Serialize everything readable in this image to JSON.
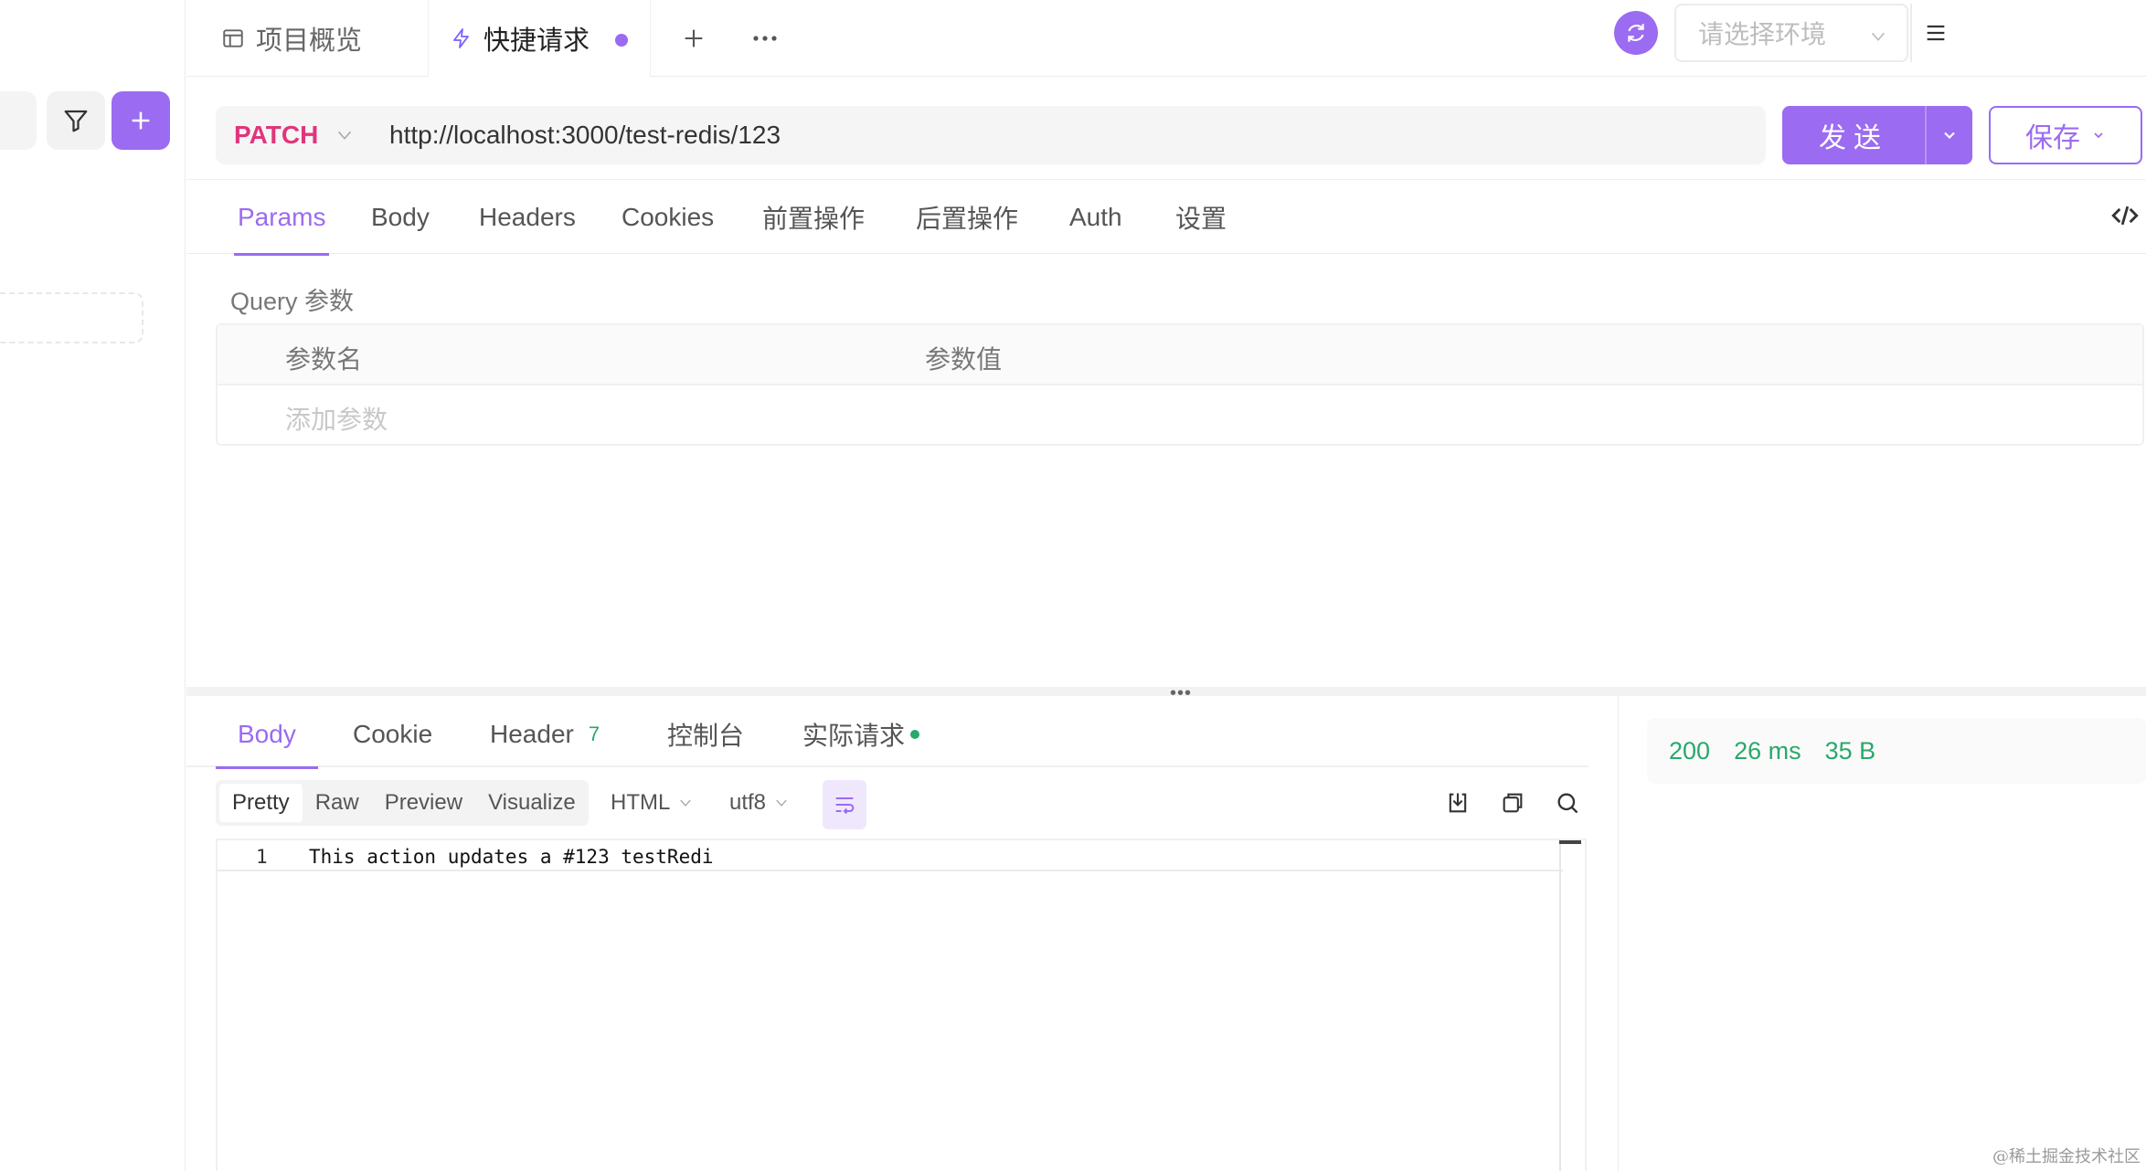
{
  "tabs": {
    "overview": "项目概览",
    "quick_request": "快捷请求",
    "add": "+",
    "more": "···"
  },
  "environment": {
    "placeholder": "请选择环境"
  },
  "request": {
    "method": "PATCH",
    "url": "http://localhost:3000/test-redis/123",
    "send_label": "发送",
    "save_label": "保存"
  },
  "request_tabs": [
    "Params",
    "Body",
    "Headers",
    "Cookies",
    "前置操作",
    "后置操作",
    "Auth",
    "设置"
  ],
  "params": {
    "section_label": "Query 参数",
    "col_name": "参数名",
    "col_value": "参数值",
    "add_placeholder": "添加参数"
  },
  "response": {
    "tabs": {
      "body": "Body",
      "cookie": "Cookie",
      "header": "Header",
      "header_count": "7",
      "console": "控制台",
      "actual_request": "实际请求"
    },
    "formats": [
      "Pretty",
      "Raw",
      "Preview",
      "Visualize"
    ],
    "content_type": "HTML",
    "encoding": "utf8",
    "lines": [
      {
        "number": "1",
        "text": "This action updates a #123 testRedi"
      }
    ],
    "status": "200",
    "time": "26 ms",
    "size": "35 B"
  },
  "watermark": "@稀土掘金技术社区",
  "colors": {
    "accent": "#9b6bf1",
    "method_patch": "#e0357b",
    "success": "#29a86b"
  }
}
